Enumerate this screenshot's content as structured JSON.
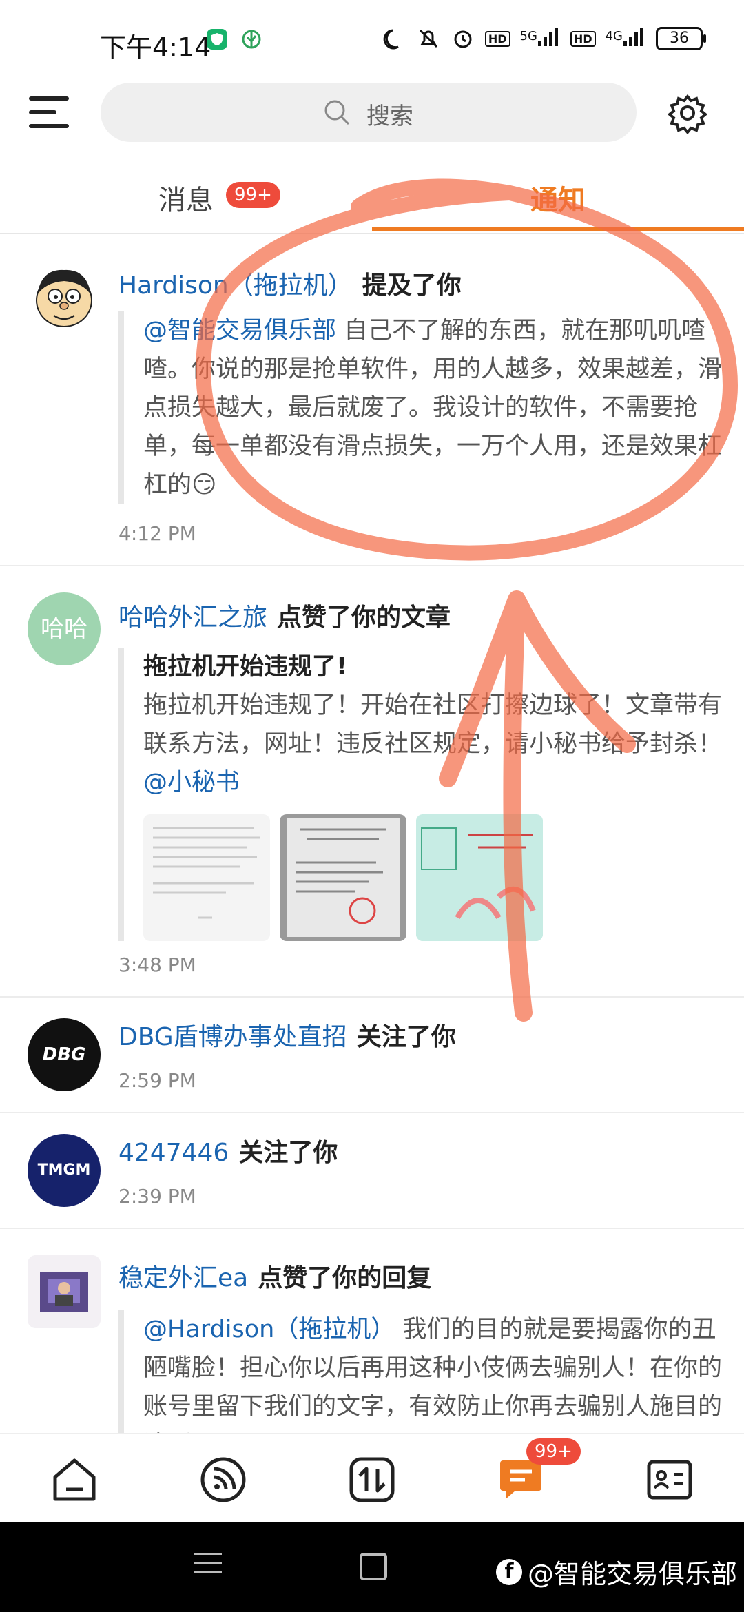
{
  "status": {
    "time": "下午4:14",
    "net1": "5G",
    "net2": "4G",
    "hd": "HD",
    "battery": "36"
  },
  "search": {
    "placeholder": "搜索"
  },
  "tabs": {
    "messages": "消息",
    "messages_badge": "99+",
    "notifications": "通知"
  },
  "items": [
    {
      "name": "Hardison（拖拉机）",
      "action": "提及了你",
      "mention": "@智能交易俱乐部",
      "text": " 自己不了解的东西，就在那叽叽喳喳。你说的那是抢单软件，用的人越多，效果越差，滑点损失越大，最后就废了。我设计的软件，不需要抢单，每一单都没有滑点损失，一万个人用，还是效果杠杠的😏",
      "time": "4:12 PM"
    },
    {
      "name": "哈哈外汇之旅",
      "avatar_text": "哈哈",
      "action": "点赞了你的文章",
      "title": "拖拉机开始违规了!",
      "text": "拖拉机开始违规了！开始在社区打擦边球了！文章带有联系方法，网址！违反社区规定，请小秘书给予封杀！ ",
      "mention": "@小秘书",
      "time": "3:48 PM"
    },
    {
      "name": "DBG盾博办事处直招",
      "avatar_text": "DBG",
      "action": "关注了你",
      "time": "2:59 PM"
    },
    {
      "name": "4247446",
      "avatar_text": "TMGM",
      "action": "关注了你",
      "time": "2:39 PM"
    },
    {
      "name": "稳定外汇ea",
      "action": "点赞了你的回复",
      "mention": "@Hardison（拖拉机）",
      "text": " 我们的目的就是要揭露你的丑陋嘴脸！担心你以后再用这种小伎俩去骗别人！在你的账号里留下我们的文字，有效防止你再去骗别人施目的达到了！"
    }
  ],
  "nav": {
    "badge": "99+"
  },
  "watermark": "@智能交易俱乐部",
  "colors": {
    "accent": "#ef7b22",
    "link": "#1a64b0",
    "badge": "#ee4b3b",
    "annotation": "#f46a45"
  }
}
